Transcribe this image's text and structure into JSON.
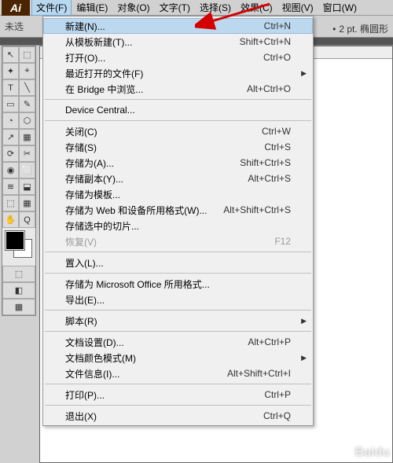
{
  "logo": "Ai",
  "menubar": [
    {
      "label": "文件(F)",
      "active": true
    },
    {
      "label": "编辑(E)"
    },
    {
      "label": "对象(O)"
    },
    {
      "label": "文字(T)"
    },
    {
      "label": "选择(S)"
    },
    {
      "label": "效果(C)"
    },
    {
      "label": "视图(V)"
    },
    {
      "label": "窗口(W)"
    }
  ],
  "toolbar": {
    "noselect": "未选",
    "stroke_opt": "2 pt. 椭圆形"
  },
  "file_menu": [
    {
      "type": "item",
      "label": "新建(N)...",
      "shortcut": "Ctrl+N",
      "hl": true
    },
    {
      "type": "item",
      "label": "从模板新建(T)...",
      "shortcut": "Shift+Ctrl+N"
    },
    {
      "type": "item",
      "label": "打开(O)...",
      "shortcut": "Ctrl+O"
    },
    {
      "type": "item",
      "label": "最近打开的文件(F)",
      "submenu": true
    },
    {
      "type": "item",
      "label": "在 Bridge 中浏览...",
      "shortcut": "Alt+Ctrl+O"
    },
    {
      "type": "sep"
    },
    {
      "type": "item",
      "label": "Device Central..."
    },
    {
      "type": "sep"
    },
    {
      "type": "item",
      "label": "关闭(C)",
      "shortcut": "Ctrl+W"
    },
    {
      "type": "item",
      "label": "存储(S)",
      "shortcut": "Ctrl+S"
    },
    {
      "type": "item",
      "label": "存储为(A)...",
      "shortcut": "Shift+Ctrl+S"
    },
    {
      "type": "item",
      "label": "存储副本(Y)...",
      "shortcut": "Alt+Ctrl+S"
    },
    {
      "type": "item",
      "label": "存储为模板..."
    },
    {
      "type": "item",
      "label": "存储为 Web 和设备所用格式(W)...",
      "shortcut": "Alt+Shift+Ctrl+S"
    },
    {
      "type": "item",
      "label": "存储选中的切片..."
    },
    {
      "type": "item",
      "label": "恢复(V)",
      "shortcut": "F12",
      "disabled": true
    },
    {
      "type": "sep"
    },
    {
      "type": "item",
      "label": "置入(L)..."
    },
    {
      "type": "sep"
    },
    {
      "type": "item",
      "label": "存储为 Microsoft Office 所用格式..."
    },
    {
      "type": "item",
      "label": "导出(E)..."
    },
    {
      "type": "sep"
    },
    {
      "type": "item",
      "label": "脚本(R)",
      "submenu": true
    },
    {
      "type": "sep"
    },
    {
      "type": "item",
      "label": "文档设置(D)...",
      "shortcut": "Alt+Ctrl+P"
    },
    {
      "type": "item",
      "label": "文档颜色模式(M)",
      "submenu": true
    },
    {
      "type": "item",
      "label": "文件信息(I)...",
      "shortcut": "Alt+Shift+Ctrl+I"
    },
    {
      "type": "sep"
    },
    {
      "type": "item",
      "label": "打印(P)...",
      "shortcut": "Ctrl+P"
    },
    {
      "type": "sep"
    },
    {
      "type": "item",
      "label": "退出(X)",
      "shortcut": "Ctrl+Q"
    }
  ],
  "tools": [
    [
      "↖",
      "⬚"
    ],
    [
      "✦",
      "⌖"
    ],
    [
      "T",
      "╲"
    ],
    [
      "▭",
      "✎"
    ],
    [
      "◔",
      "⬡"
    ],
    [
      "↗",
      "▦"
    ],
    [
      "⟳",
      "✂"
    ],
    [
      "◉",
      "⬜"
    ],
    [
      "≋",
      "⬓"
    ],
    [
      "⬚",
      "▦"
    ],
    [
      "✋",
      "Q"
    ]
  ],
  "watermark": "Baidu"
}
